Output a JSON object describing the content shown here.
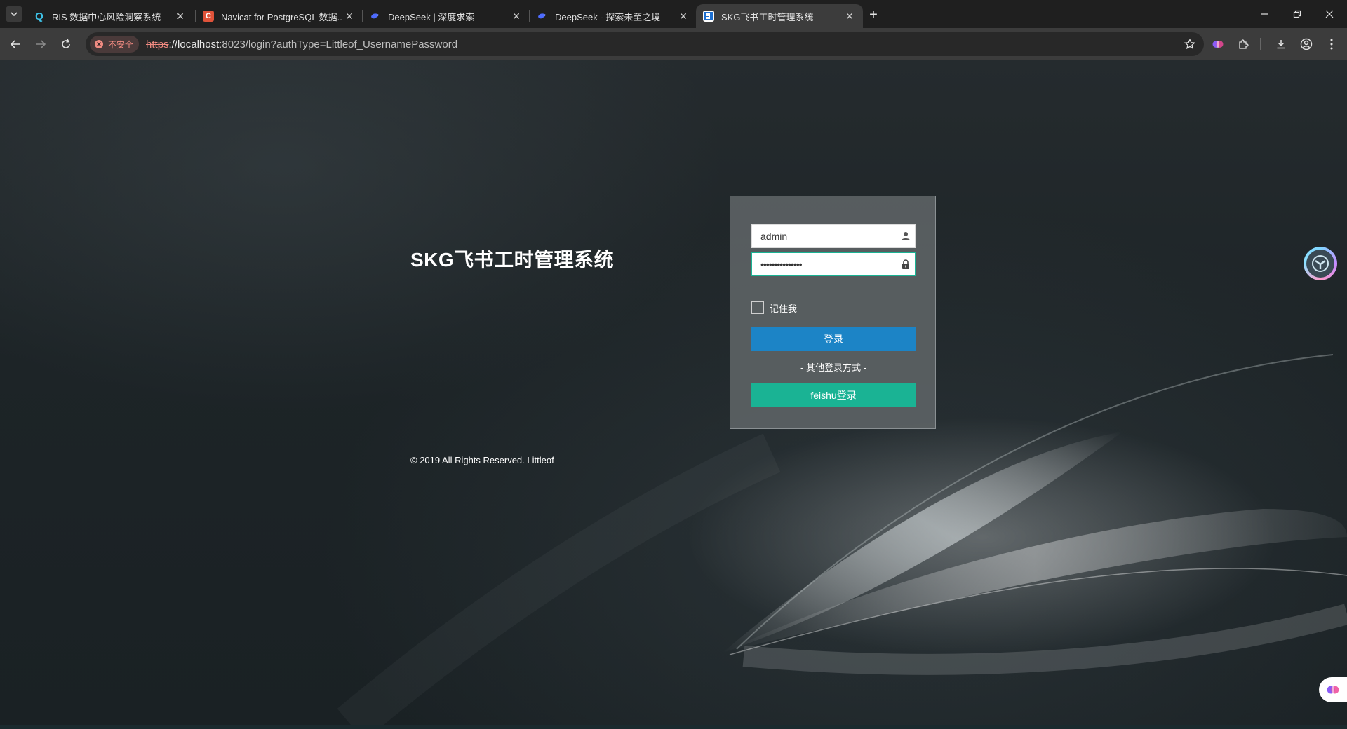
{
  "browser": {
    "tabs": [
      {
        "title": "RIS 数据中心风险洞察系统",
        "favicon": "ris-logo-icon",
        "active": false
      },
      {
        "title": "Navicat for PostgreSQL 数据...",
        "favicon": "navicat-logo-icon",
        "active": false
      },
      {
        "title": "DeepSeek | 深度求索",
        "favicon": "deepseek-whale-icon",
        "active": false
      },
      {
        "title": "DeepSeek - 探索未至之境",
        "favicon": "deepseek-whale-icon",
        "active": false
      },
      {
        "title": "SKG飞书工时管理系统",
        "favicon": "site-favicon-icon",
        "active": true
      }
    ],
    "address_bar": {
      "security_label": "不安全",
      "url_scheme": "https",
      "url_host": "://localhost",
      "url_rest": ":8023/login?authType=Littleof_UsernamePassword"
    }
  },
  "login": {
    "system_title": "SKG飞书工时管理系统",
    "username_value": "admin",
    "password_value": "•••••••••••••••",
    "remember_label": "记住我",
    "login_button": "登录",
    "other_methods": "- 其他登录方式 -",
    "feishu_button": "feishu登录"
  },
  "footer": {
    "copyright": "© 2019 All Rights Reserved. Littleof"
  },
  "colors": {
    "login_button": "#1c84c6",
    "feishu_button": "#1ab394",
    "insecure": "#f28b82"
  }
}
